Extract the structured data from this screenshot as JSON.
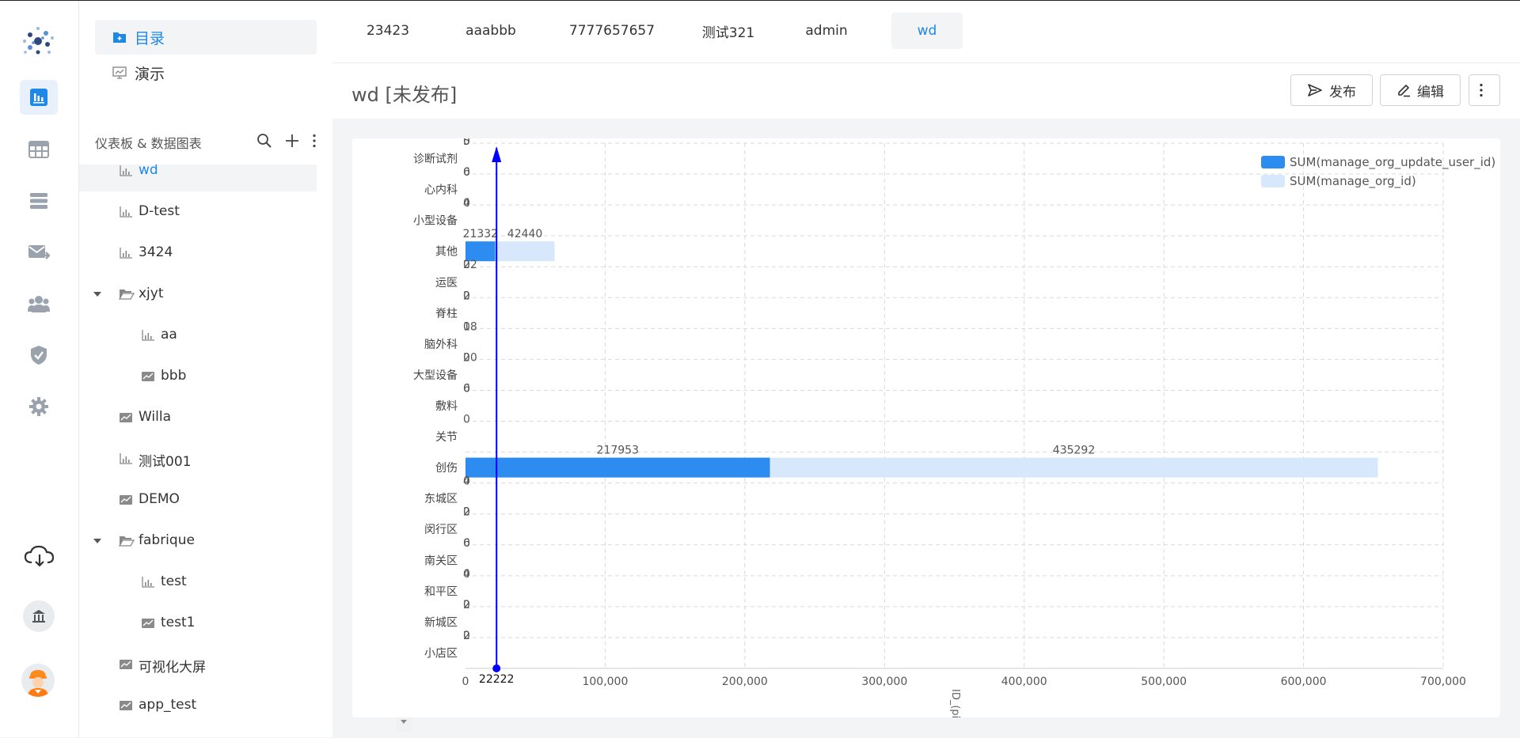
{
  "nav_icons": [
    "dashboard-icon",
    "table-icon",
    "database-icon",
    "mail-forward-icon",
    "users-icon",
    "shield-check-icon",
    "gear-icon"
  ],
  "tree": {
    "modes": [
      {
        "label": "目录",
        "icon": "folder-icon",
        "selected": true
      },
      {
        "label": "演示",
        "icon": "presentation-icon",
        "selected": false
      }
    ],
    "section_title": "仪表板 & 数据图表",
    "nodes": [
      {
        "label": "wd",
        "type": "chart",
        "level": 1,
        "selected": true
      },
      {
        "label": "D-test",
        "type": "chart",
        "level": 1
      },
      {
        "label": "3424",
        "type": "chart",
        "level": 1
      },
      {
        "label": "xjyt",
        "type": "folder",
        "level": 1,
        "expanded": true
      },
      {
        "label": "aa",
        "type": "chart",
        "level": 2
      },
      {
        "label": "bbb",
        "type": "dashboard",
        "level": 2
      },
      {
        "label": "Willa",
        "type": "dashboard",
        "level": 1
      },
      {
        "label": "测试001",
        "type": "chart",
        "level": 1
      },
      {
        "label": "DEMO",
        "type": "dashboard",
        "level": 1
      },
      {
        "label": "fabrique",
        "type": "folder",
        "level": 1,
        "expanded": true
      },
      {
        "label": "test",
        "type": "chart",
        "level": 2
      },
      {
        "label": "test1",
        "type": "dashboard",
        "level": 2
      },
      {
        "label": "可视化大屏",
        "type": "dashboard",
        "level": 1
      },
      {
        "label": "app_test",
        "type": "dashboard",
        "level": 1
      }
    ]
  },
  "tabs": [
    {
      "label": "23423"
    },
    {
      "label": "aaabbb"
    },
    {
      "label": "7777657657"
    },
    {
      "label": "测试321"
    },
    {
      "label": "admin"
    },
    {
      "label": "wd",
      "active": true
    }
  ],
  "header": {
    "title": "wd [未发布]",
    "publish_label": "发布",
    "edit_label": "编辑"
  },
  "colors": {
    "accent": "#1d88e5",
    "series1": "#2d8cf0",
    "series2": "#d7e8fc",
    "marker": "#0000ff"
  },
  "chart_data": {
    "type": "bar",
    "orientation": "horizontal",
    "stacked": true,
    "categories": [
      "诊断试剂",
      "心内科",
      "小型设备",
      "其他",
      "运医",
      "脊柱",
      "脑外科",
      "大型设备",
      "敷料",
      "关节",
      "创伤",
      "东城区",
      "闵行区",
      "南关区",
      "和平区",
      "新城区",
      "小店区"
    ],
    "series": [
      {
        "name": "SUM(manage_org_update_user_id)",
        "values": [
          0,
          0,
          0,
          21332,
          0,
          0,
          0,
          0,
          0,
          0,
          217953,
          0,
          0,
          0,
          0,
          0,
          0
        ],
        "labels": [
          "0",
          "0",
          "0",
          "21332",
          "0",
          "0",
          "0",
          "0",
          "0",
          "0",
          "217953",
          "0",
          "0",
          "0",
          "0",
          "0",
          "0"
        ]
      },
      {
        "name": "SUM(manage_org_id)",
        "values": [
          5,
          6,
          4,
          42440,
          22,
          2,
          18,
          20,
          6,
          0,
          435292,
          4,
          2,
          6,
          4,
          2,
          2
        ],
        "labels": [
          "5",
          "6",
          "4",
          "42440",
          "22",
          "2",
          "18",
          "20",
          "6",
          "",
          "435292",
          "4",
          "2",
          "6",
          "4",
          "2",
          "2"
        ]
      }
    ],
    "xlim": [
      0,
      700000
    ],
    "xticks": [
      "0",
      "100,000",
      "200,000",
      "300,000",
      "400,000",
      "500,000",
      "600,000",
      "700,000"
    ],
    "xlabel": "ID_(pi)",
    "marker_line": {
      "value": 22222,
      "label": "22222"
    },
    "legend": "top-right",
    "grid": true
  }
}
